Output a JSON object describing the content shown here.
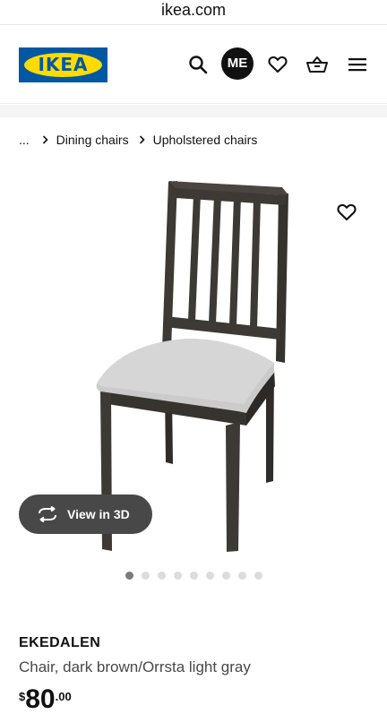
{
  "browser": {
    "url": "ikea.com"
  },
  "header": {
    "logo_text": "IKEA",
    "account_label": "ME",
    "icons": [
      "search-icon",
      "account-icon",
      "heart-icon",
      "basket-icon",
      "menu-icon"
    ]
  },
  "breadcrumb": {
    "ellipsis": "...",
    "items": [
      "Dining chairs",
      "Upholstered chairs"
    ]
  },
  "gallery": {
    "view_3d_label": "View in 3D",
    "image_count": 9,
    "active_index": 0
  },
  "product": {
    "name": "EKEDALEN",
    "description": "Chair, dark brown/Orrsta light gray",
    "price_currency": "$",
    "price_integer": "80",
    "price_decimal": ".00"
  },
  "colors": {
    "brand_blue": "#0058a3",
    "brand_yellow": "#ffdb00",
    "chair_wood": "#3d3935",
    "seat_fabric": "#c9c9c9"
  }
}
